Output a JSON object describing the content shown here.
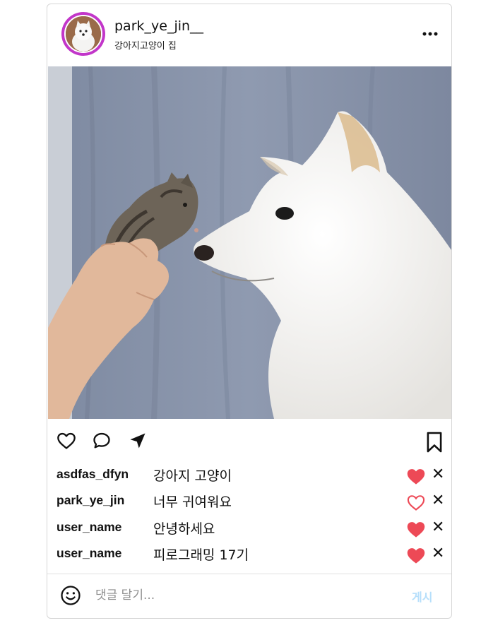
{
  "post": {
    "username": "park_ye_jin__",
    "location": "강아지고양이 집",
    "more_icon": "more-horizontal-icon",
    "photo_alt": "dog and kitten"
  },
  "actions": {
    "like_icon": "heart-outline-icon",
    "comment_icon": "comment-icon",
    "share_icon": "send-icon",
    "save_icon": "bookmark-icon"
  },
  "comments": [
    {
      "user": "asdfas_dfyn",
      "text": "강아지 고양이",
      "liked": true
    },
    {
      "user": "park_ye_jin",
      "text": "너무 귀여워요",
      "liked": false
    },
    {
      "user": "user_name",
      "text": "안녕하세요",
      "liked": true
    },
    {
      "user": "user_name",
      "text": "피로그래밍 17기",
      "liked": true
    }
  ],
  "comment_form": {
    "placeholder": "댓글 달기...",
    "submit_label": "게시"
  },
  "colors": {
    "liked_heart": "#ed4956",
    "avatar_ring": "#c236c9",
    "post_button_disabled": "#b6dffb"
  }
}
